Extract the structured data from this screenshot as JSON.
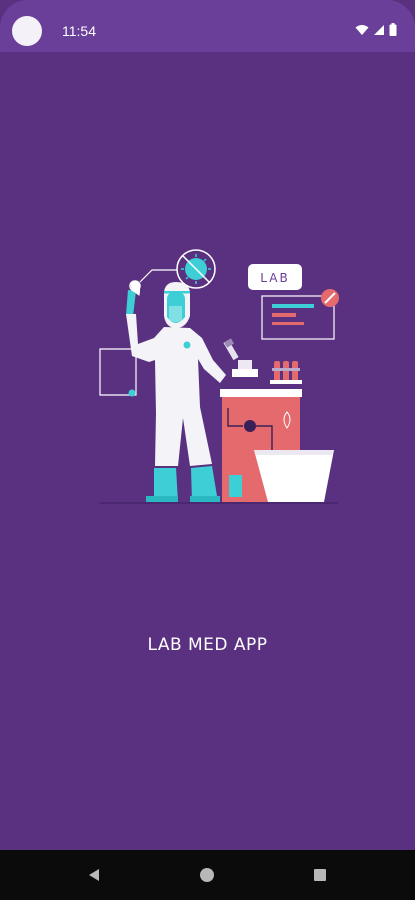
{
  "status_bar": {
    "time": "11:54",
    "icons": [
      "wifi-icon",
      "cellular-signal-icon",
      "battery-icon"
    ]
  },
  "app": {
    "title": "LAB MED APP",
    "illustration_sign_label": "LAB",
    "colors": {
      "background": "#5a3180",
      "status_bar": "#6a3f9a",
      "accent_teal": "#3ecfd6",
      "accent_coral": "#e46a6d",
      "nav_bar": "#0b0b0b"
    }
  },
  "navigation_bar": {
    "buttons": [
      "back-icon",
      "home-icon",
      "recents-icon"
    ]
  }
}
